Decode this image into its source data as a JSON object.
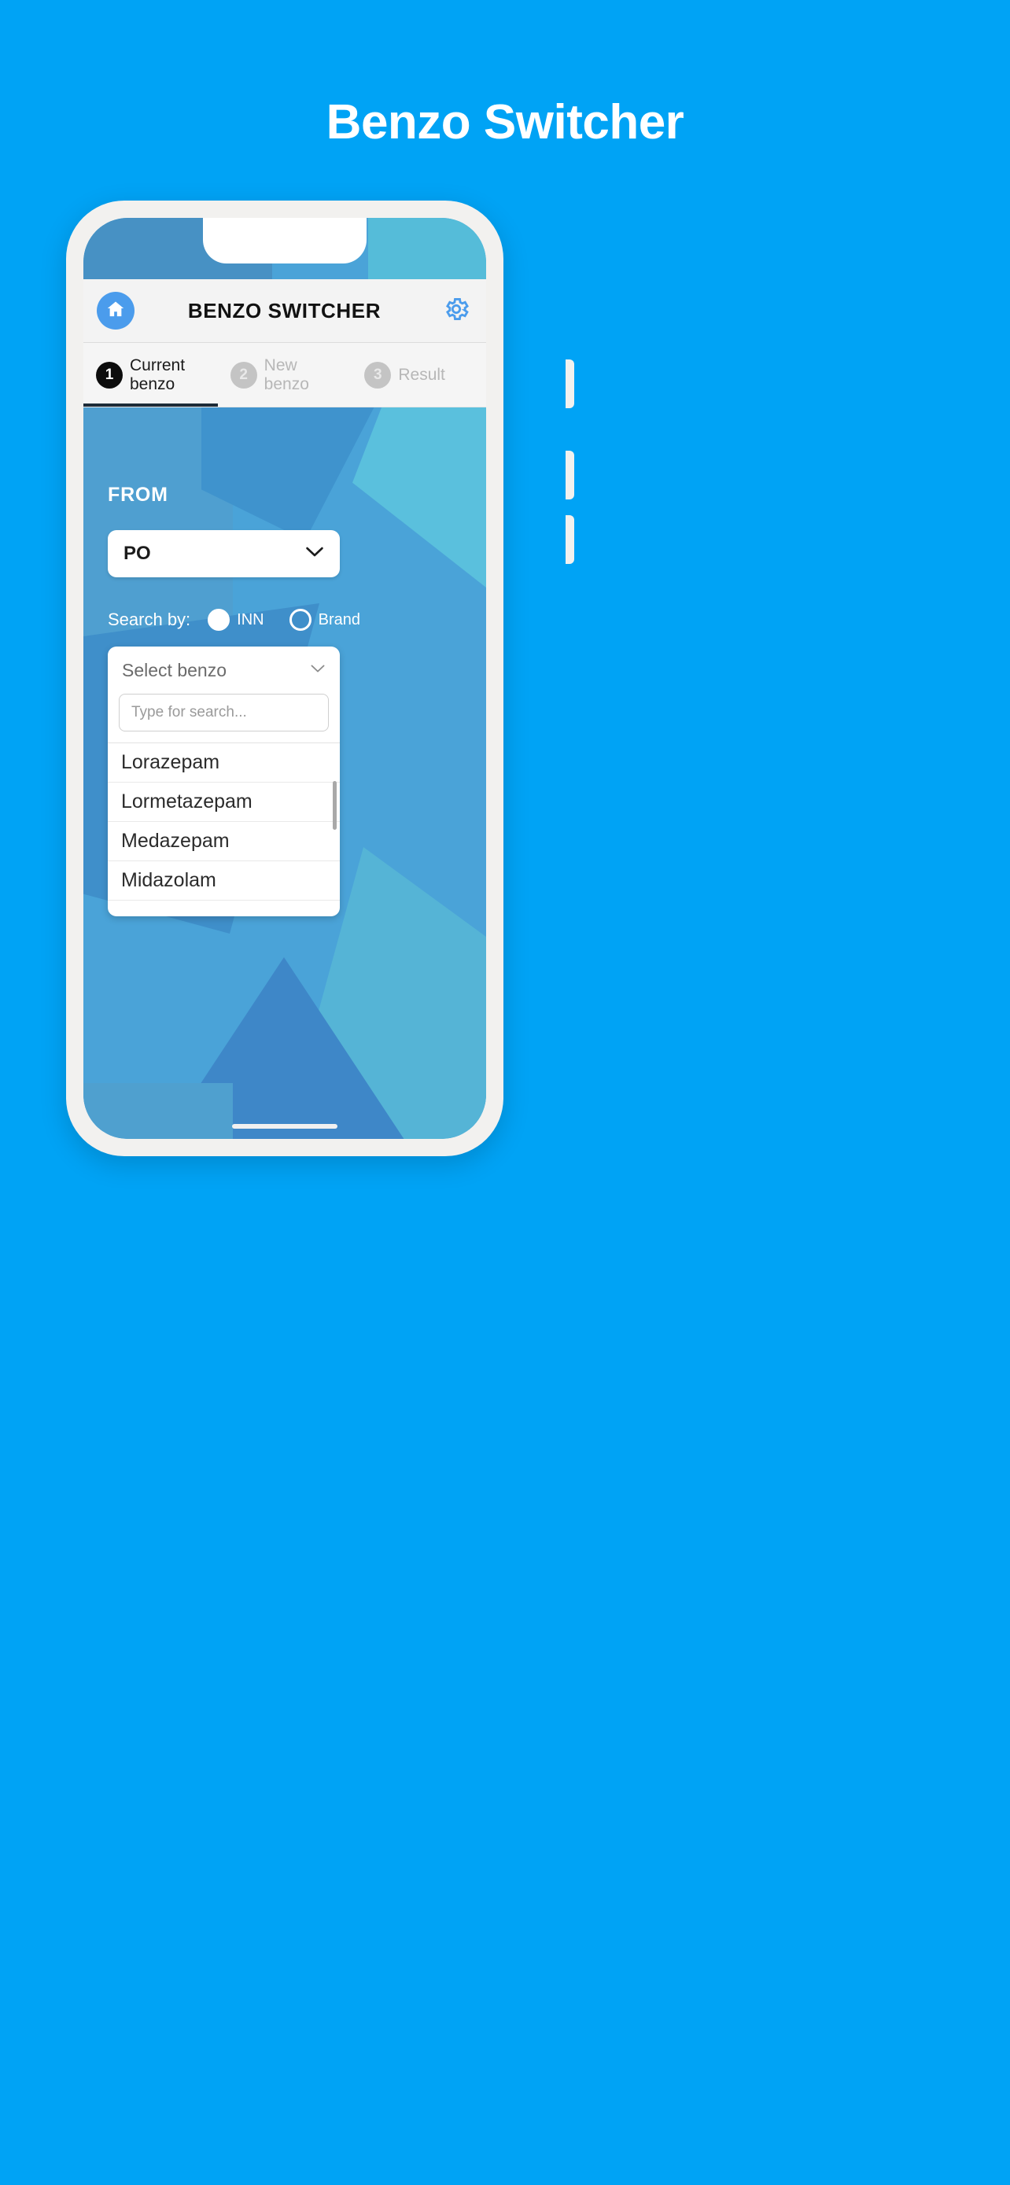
{
  "page": {
    "title": "Benzo Switcher",
    "background_color": "#00A3F5"
  },
  "phone": {
    "app_bar": {
      "home_icon": "home-icon",
      "title": "BENZO SWITCHER",
      "settings_icon": "gear-icon",
      "home_button_color": "#4b9cec",
      "settings_icon_color": "#4b9cec"
    },
    "stepper": {
      "steps": [
        {
          "number": "1",
          "label": "Current benzo",
          "active": true
        },
        {
          "number": "2",
          "label": "New benzo",
          "active": false
        },
        {
          "number": "3",
          "label": "Result",
          "active": false
        }
      ]
    },
    "form": {
      "section_label": "FROM",
      "route_select": {
        "value": "PO",
        "chevron_icon": "chevron-down-icon"
      },
      "search_by": {
        "label": "Search by:",
        "options": [
          {
            "label": "INN",
            "selected": true
          },
          {
            "label": "Brand",
            "selected": false
          }
        ]
      },
      "benzo_dropdown": {
        "placeholder": "Select benzo",
        "chevron_icon": "chevron-down-icon",
        "search_placeholder": "Type for search...",
        "search_value": "",
        "items": [
          "Lorazepam",
          "Lormetazepam",
          "Medazepam",
          "Midazolam"
        ]
      }
    }
  }
}
